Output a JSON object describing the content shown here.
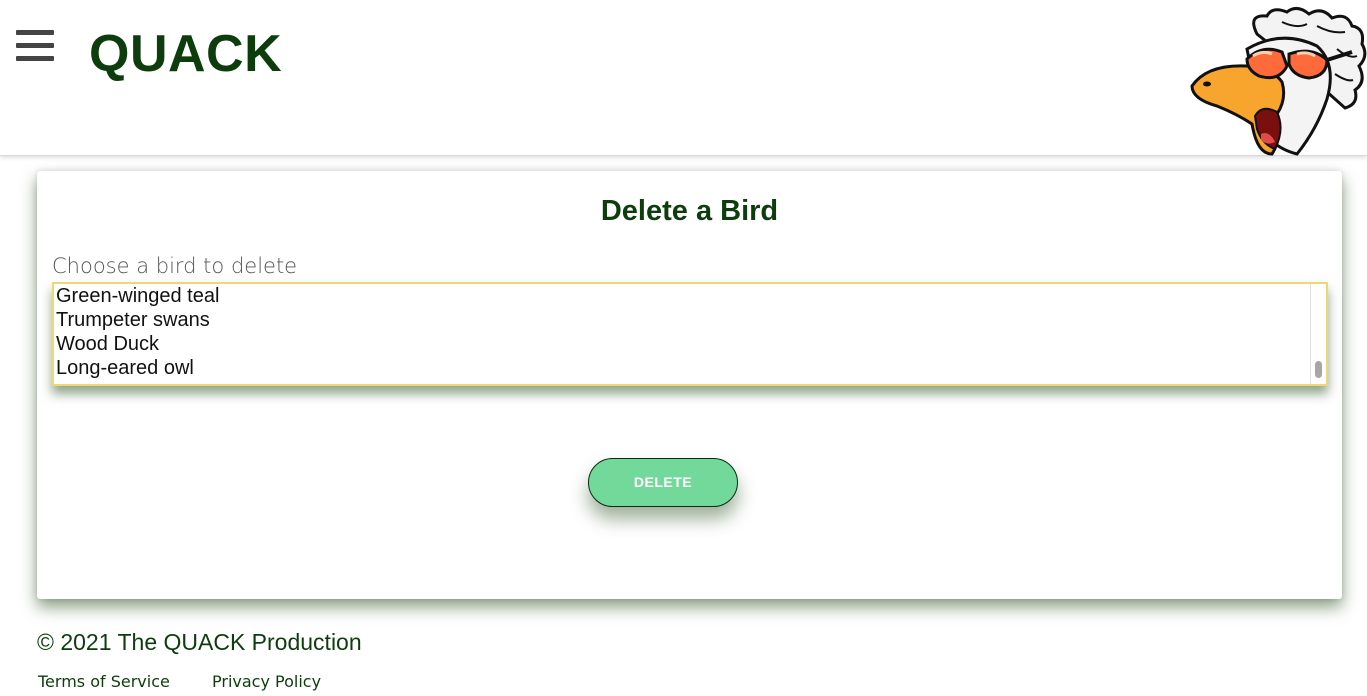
{
  "header": {
    "brand": "QUACK",
    "menu_icon": "hamburger-menu-icon",
    "logo": "duck-with-sunglasses-logo"
  },
  "main": {
    "title": "Delete a Bird",
    "field_label": "Choose a bird to delete",
    "birds": [
      "Green-winged teal",
      "Trumpeter swans",
      "Wood Duck",
      "Long-eared owl"
    ],
    "delete_label": "DELETE"
  },
  "footer": {
    "copyright": "© 2021 The QUACK Production",
    "links": [
      "Terms of Service",
      "Privacy Policy"
    ]
  },
  "colors": {
    "brand": "#0d3d0d",
    "button": "#72d99a",
    "focus_border": "#f1d674"
  }
}
